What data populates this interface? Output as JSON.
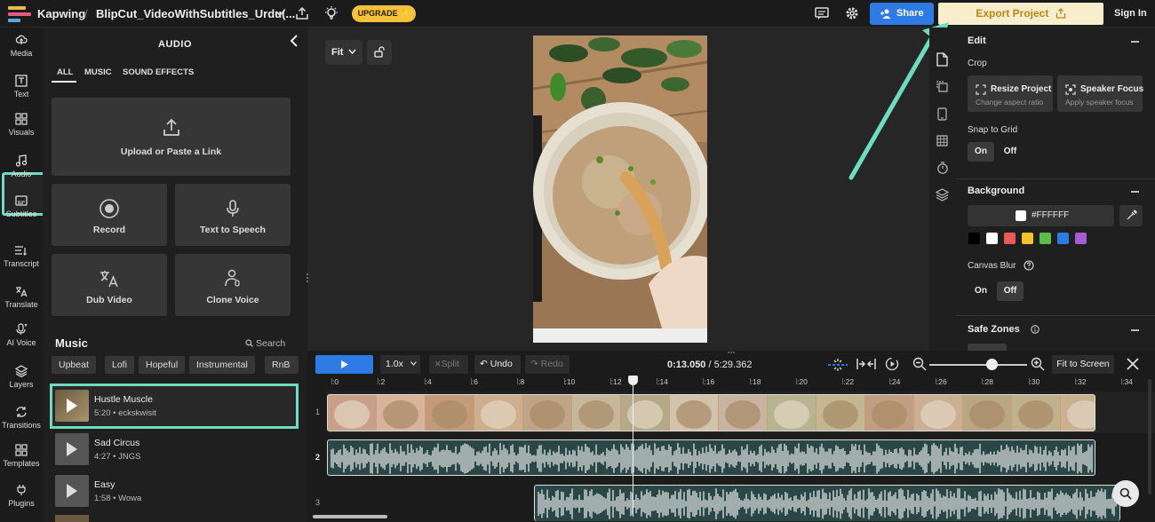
{
  "topbar": {
    "brand": "Kapwing",
    "separator": "/",
    "project_name": "BlipCut_VideoWithSubtitles_Urdu(...",
    "upgrade_label": "UPGRADE ✨",
    "share_label": "Share",
    "export_label": "Export Project",
    "signin_label": "Sign In"
  },
  "leftnav": {
    "items": [
      {
        "label": "Media",
        "icon": "media-icon"
      },
      {
        "label": "Text",
        "icon": "text-icon"
      },
      {
        "label": "Visuals",
        "icon": "visuals-icon"
      },
      {
        "label": "Audio",
        "icon": "audio-icon"
      },
      {
        "label": "Subtitles",
        "icon": "subtitles-icon"
      },
      {
        "label": "Transcript",
        "icon": "transcript-icon"
      },
      {
        "label": "Translate",
        "icon": "translate-icon"
      },
      {
        "label": "AI Voice",
        "icon": "ai-voice-icon"
      },
      {
        "label": "Layers",
        "icon": "layers-icon"
      },
      {
        "label": "Transitions",
        "icon": "transitions-icon"
      },
      {
        "label": "Templates",
        "icon": "templates-icon"
      },
      {
        "label": "Plugins",
        "icon": "plugins-icon"
      }
    ]
  },
  "audio_panel": {
    "title": "AUDIO",
    "tabs": [
      "ALL",
      "MUSIC",
      "SOUND EFFECTS"
    ],
    "upload_label": "Upload or Paste a Link",
    "cards": [
      "Record",
      "Text to Speech",
      "Dub Video",
      "Clone Voice"
    ],
    "music_heading": "Music",
    "search_label": "Search",
    "chips": [
      "Upbeat",
      "Lofi",
      "Hopeful",
      "Instrumental",
      "RnB"
    ],
    "tracks": [
      {
        "title": "Hustle Muscle",
        "meta": "5:20 • eckskwisit"
      },
      {
        "title": "Sad Circus",
        "meta": "4:27 • JNGS"
      },
      {
        "title": "Easy",
        "meta": "1:58 • Wowa"
      }
    ]
  },
  "stage": {
    "fit_label": "Fit"
  },
  "right_panel": {
    "edit_heading": "Edit",
    "crop_label": "Crop",
    "resize_title": "Resize Project",
    "resize_sub": "Change aspect ratio",
    "speaker_title": "Speaker Focus",
    "speaker_sub": "Apply speaker focus",
    "snap_label": "Snap to Grid",
    "on_label": "On",
    "off_label": "Off",
    "background_heading": "Background",
    "bg_color": "#FFFFFF",
    "swatches": [
      "#000000",
      "#FFFFFF",
      "#E85B5B",
      "#F4C12E",
      "#5DBB4A",
      "#2F7BE5",
      "#A55BD1"
    ],
    "canvas_blur_label": "Canvas Blur",
    "safe_zones_heading": "Safe Zones"
  },
  "timeline": {
    "speed_label": "1.0x",
    "split_label": "Split",
    "undo_label": "Undo",
    "redo_label": "Redo",
    "current_time": "0:13.050",
    "total_time": "/ 5:29.362",
    "fit_screen_label": "Fit to Screen",
    "ticks": [
      ":0",
      ":2",
      ":4",
      ":6",
      ":8",
      ":10",
      ":12",
      ":14",
      ":16",
      ":18",
      ":20",
      ":22",
      ":24",
      ":26",
      ":28",
      ":30",
      ":32",
      ":34"
    ],
    "rows": [
      "1",
      "2",
      "3"
    ]
  },
  "colors": {
    "accent": "#2f7be5",
    "highlight": "#6ddcc0",
    "export_bg": "#f8edcc",
    "upgrade": "#f7c13b"
  }
}
